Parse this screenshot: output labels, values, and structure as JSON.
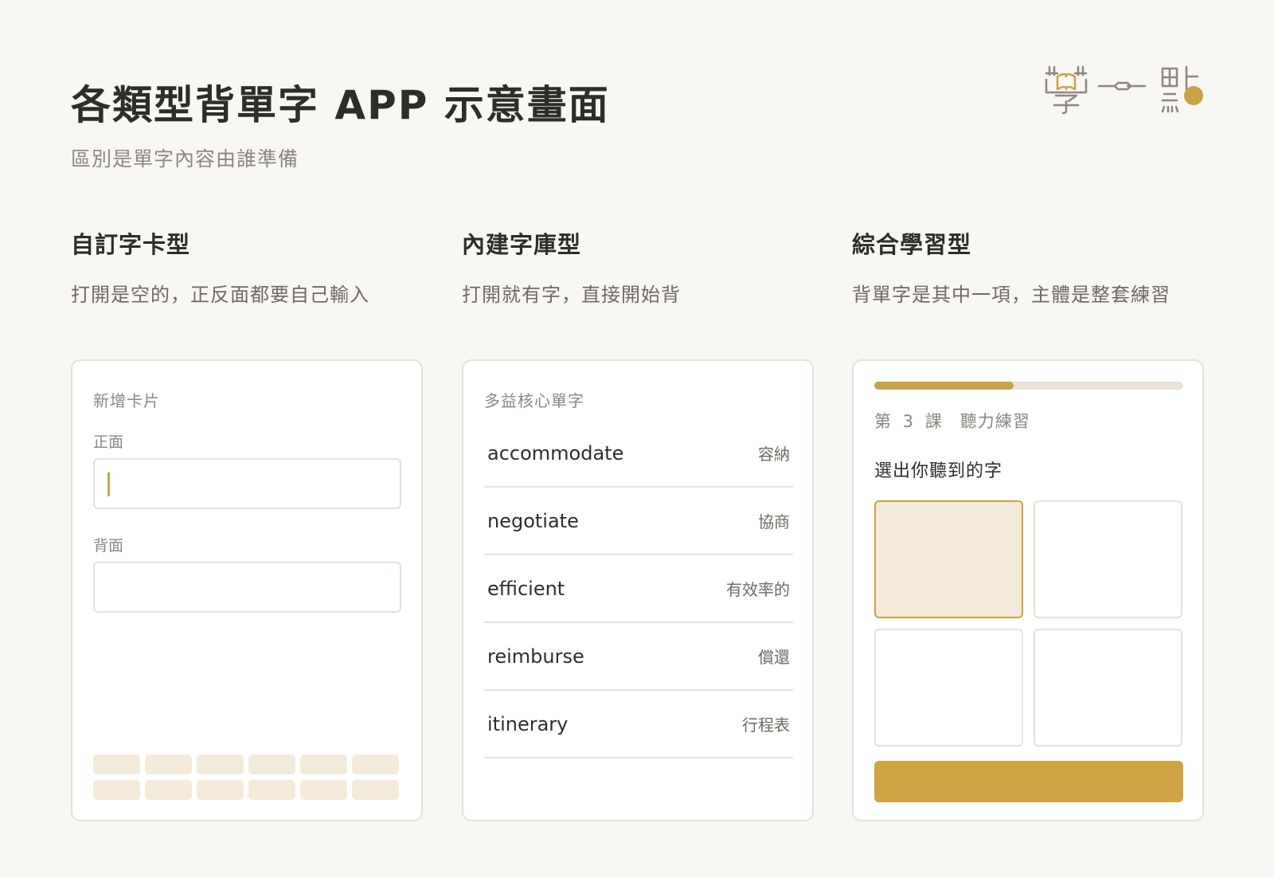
{
  "header": {
    "title": "各類型背單字 APP 示意畫面",
    "subtitle": "區別是單字內容由誰準備",
    "logo_icon": "book-pen-logo-icon"
  },
  "columns": [
    {
      "heading": "自訂字卡型",
      "description": "打開是空的，正反面都要自己輸入"
    },
    {
      "heading": "內建字庫型",
      "description": "打開就有字，直接開始背"
    },
    {
      "heading": "綜合學習型",
      "description": "背單字是其中一項，主體是整套練習"
    }
  ],
  "card1": {
    "title": "新增卡片",
    "front_label": "正面",
    "front_value": "",
    "back_label": "背面",
    "back_value": ""
  },
  "card2": {
    "title": "多益核心單字",
    "words": [
      {
        "en": "accommodate",
        "zh": "容納"
      },
      {
        "en": "negotiate",
        "zh": "協商"
      },
      {
        "en": "efficient",
        "zh": "有效率的"
      },
      {
        "en": "reimburse",
        "zh": "償還"
      },
      {
        "en": "itinerary",
        "zh": "行程表"
      }
    ]
  },
  "card3": {
    "progress_fraction": 0.45,
    "lesson": "第 3 課　聽力練習",
    "question": "選出你聽到的字",
    "selected_option_index": 0
  },
  "colors": {
    "accent": "#c9a24a",
    "accent_light": "#f3eada",
    "border": "#e6e1d8",
    "background": "#f9f7f3"
  }
}
